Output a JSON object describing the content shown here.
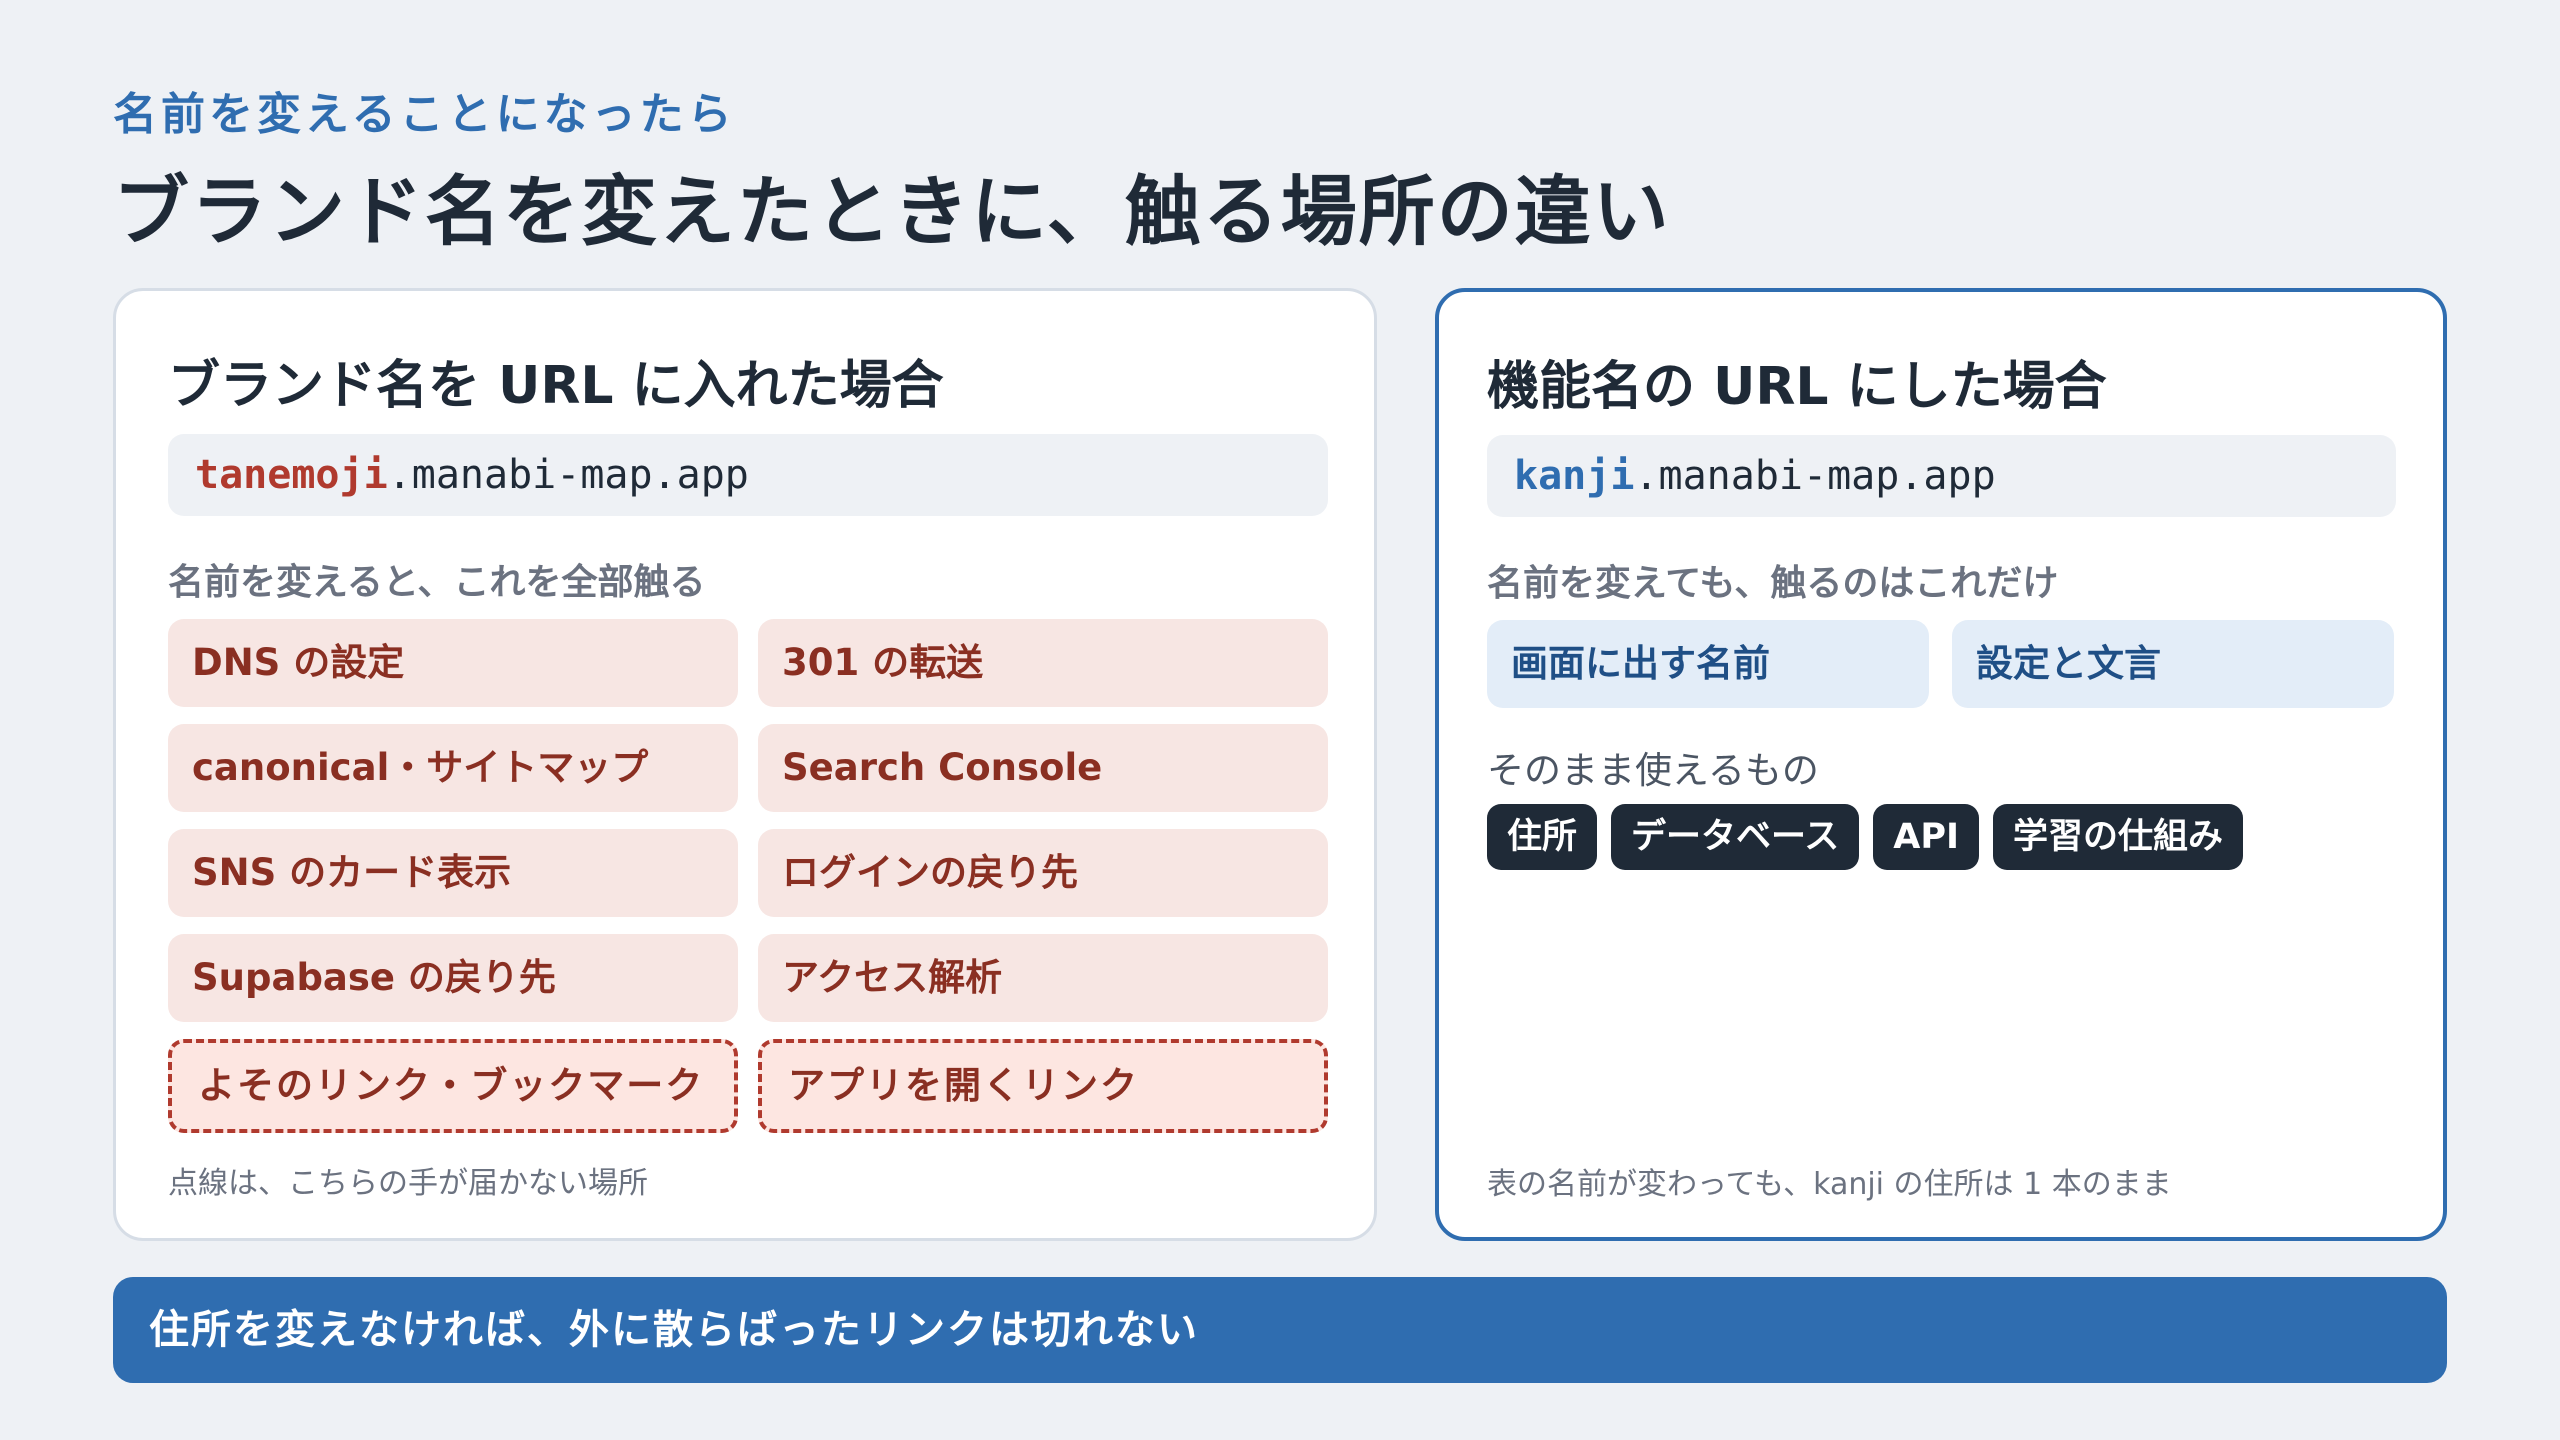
{
  "header": {
    "eyebrow": "名前を変えることになったら",
    "title": "ブランド名を変えたときに、触る場所の違い"
  },
  "left_card": {
    "title": "ブランド名を URL に入れた場合",
    "url_sub": "tanemoji",
    "url_rest": ".manabi-map.app",
    "section_label": "名前を変えると、これを全部触る",
    "items": [
      "DNS の設定",
      "301 の転送",
      "canonical・サイトマップ",
      "Search Console",
      "SNS のカード表示",
      "ログインの戻り先",
      "Supabase の戻り先",
      "アクセス解析"
    ],
    "external_items": [
      "よそのリンク・ブックマーク",
      "アプリを開くリンク"
    ],
    "footnote": "点線は、こちらの手が届かない場所"
  },
  "right_card": {
    "title": "機能名の URL にした場合",
    "url_sub": "kanji",
    "url_rest": ".manabi-map.app",
    "section_label": "名前を変えても、触るのはこれだけ",
    "items": [
      "画面に出す名前",
      "設定と文言"
    ],
    "unchanged_label": "そのまま使えるもの",
    "unchanged_items": [
      "住所",
      "データベース",
      "API",
      "学習の仕組み"
    ],
    "footnote": "表の名前が変わっても、kanji の住所は 1 本のまま"
  },
  "banner": {
    "text": "住所を変えなければ、外に散らばったリンクは切れない"
  },
  "colors": {
    "accent_blue": "#2f6db0",
    "accent_red": "#b03a2e",
    "dark": "#1f2a37"
  }
}
